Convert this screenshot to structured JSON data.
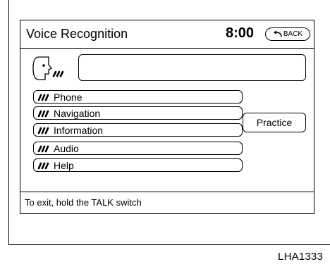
{
  "header": {
    "title": "Voice Recognition",
    "time": "8:00",
    "back_label": "BACK"
  },
  "commands": [
    {
      "label": "Phone",
      "icon": "talk-icon"
    },
    {
      "label": "Navigation",
      "icon": "talk-icon"
    },
    {
      "label": "Information",
      "icon": "talk-icon"
    },
    {
      "label": "Audio",
      "icon": "talk-icon"
    },
    {
      "label": "Help",
      "icon": "talk-icon"
    }
  ],
  "practice_label": "Practice",
  "status_text": "To exit, hold the TALK switch",
  "figure_id": "LHA1333"
}
